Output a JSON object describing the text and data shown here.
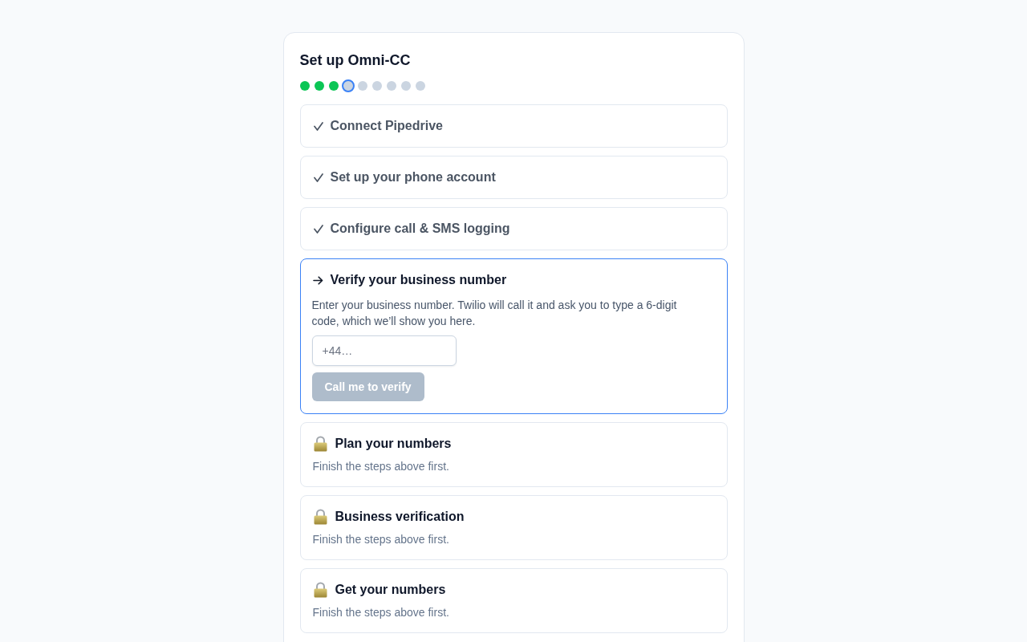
{
  "setup": {
    "title": "Set up Omni-CC",
    "progress_dots": [
      {
        "kind": "done"
      },
      {
        "kind": "done"
      },
      {
        "kind": "done"
      },
      {
        "kind": "current"
      },
      {
        "kind": "pending"
      },
      {
        "kind": "pending"
      },
      {
        "kind": "pending"
      },
      {
        "kind": "pending"
      },
      {
        "kind": "pending"
      }
    ],
    "steps": [
      {
        "kind": "done",
        "title": "Connect Pipedrive"
      },
      {
        "kind": "done",
        "title": "Set up your phone account"
      },
      {
        "kind": "done",
        "title": "Configure call & SMS logging"
      },
      {
        "kind": "active",
        "title": "Verify your business number",
        "description": "Enter your business number. Twilio will call it and ask you to type a 6-digit code, which we’ll show you here.",
        "phone_field": {
          "placeholder": "+44…"
        },
        "verify_button": {
          "label": "Call me to verify",
          "disabled": true
        }
      },
      {
        "kind": "locked",
        "title": "Plan your numbers",
        "note": "Finish the steps above first."
      },
      {
        "kind": "locked",
        "title": "Business verification",
        "note": "Finish the steps above first."
      },
      {
        "kind": "locked",
        "title": "Get your numbers",
        "note": "Finish the steps above first."
      }
    ]
  }
}
